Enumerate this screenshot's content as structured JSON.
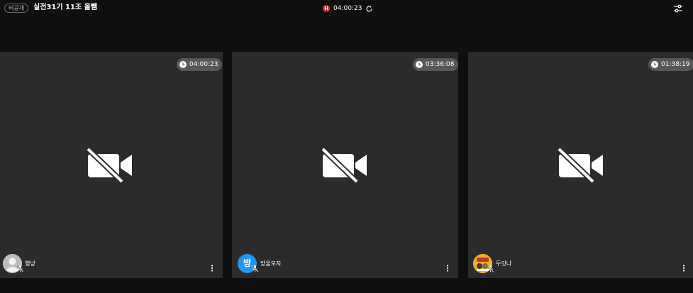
{
  "header": {
    "privacy_label": "비공개",
    "room_title": "실전31기 11조 올뺌",
    "rec_label": "H",
    "elapsed": "04:00:23",
    "icons": [
      "refresh-icon",
      "settings-sliders-icon"
    ],
    "rec_color": "#e0242d"
  },
  "tiles": [
    {
      "name": "행냥",
      "duration": "04:00:23",
      "avatar_letter": "",
      "avatar_color": "#bdbdbd"
    },
    {
      "name": "방울모자",
      "duration": "03:36:08",
      "avatar_letter": "방",
      "avatar_color": "#2196f3"
    },
    {
      "name": "두잇나",
      "duration": "01:38:19",
      "avatar_letter": "",
      "avatar_color": "#f0b323"
    }
  ],
  "colors": {
    "background": "#0f0f0f",
    "tile": "#2b2b2b",
    "pill": "#575757"
  }
}
